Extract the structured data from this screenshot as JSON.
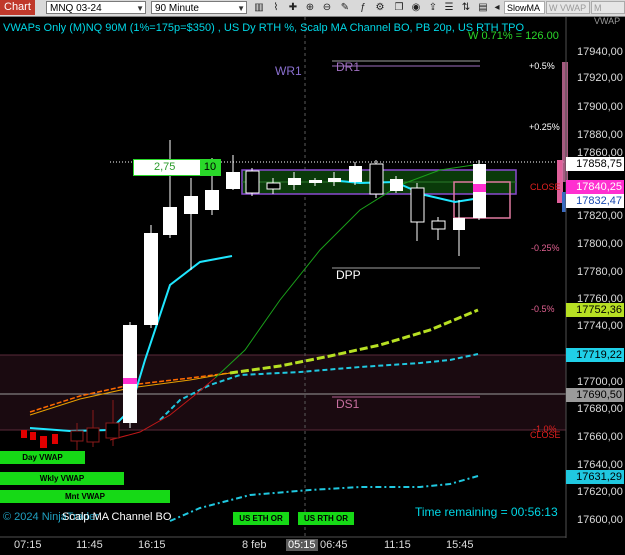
{
  "toolbar": {
    "tab_label": "Chart",
    "instrument": "MNQ 03-24",
    "interval": "90 Minute",
    "indicator": "SlowMA",
    "tab_w_vwap": "W VWAP",
    "tab_m_vwap": "M VWAP"
  },
  "chart": {
    "title": "VWAPs Only (M)NQ 90M  (1%=175p=$350) , US Dy RTH %, Scalp MA Channel BO, PB 20p, US RTH TPO",
    "overlay_text": "W 0.71% = 126.00",
    "copyright": "© 2024 NinjaTrader",
    "scalp_label": "Scalp MA Channel BO",
    "time_remaining": "Time remaining = 00:56:13",
    "callout_value": "2,75",
    "callout_count": "10"
  },
  "levels": {
    "wr1": "WR1",
    "dr1": "DR1",
    "dpp": "DPP",
    "ds1": "DS1"
  },
  "percent_labels": {
    "p05": "+0.5%",
    "p025": "+0.25%",
    "m025": "-0.25%",
    "m05": "-0.5%",
    "m1": "-1.0%",
    "close1": "CLOSE",
    "close2": "CLOSE"
  },
  "buttons": {
    "day_vwap": "Day VWAP",
    "wkly_vwap": "Wkly VWAP",
    "mnt_vwap": "Mnt VWAP",
    "us_eth_or": "US ETH OR",
    "us_rth_or": "US RTH OR"
  },
  "price_axis": {
    "ticks": [
      "17940,00",
      "17920,00",
      "17900,00",
      "17880,00",
      "17860,00",
      "17820,00",
      "17800,00",
      "17780,00",
      "17760,00",
      "17740,00",
      "17700,00",
      "17680,00",
      "17660,00",
      "17640,00",
      "17620,00",
      "17600,00"
    ],
    "boxes": {
      "last": "17858,75",
      "mid": "17840,25",
      "blue": "17832,47",
      "green": "17752,36",
      "cyan": "17719,22",
      "gray": "17690,50",
      "cyan2": "17631,29"
    }
  },
  "time_axis": {
    "ticks": [
      "07:15",
      "11:45",
      "16:15",
      "8 feb",
      "05:15",
      "06:45",
      "11:15",
      "15:45"
    ],
    "highlight": "05:15"
  },
  "colors": {
    "background": "#000000",
    "title": "#00d7e6",
    "day_vwap": "#1fe6ff",
    "week_vwap": "#b7e023",
    "month_vwap": "#20c8e0",
    "bull_candle": "#ffffff",
    "bear_candle": "#000000",
    "magenta": "#ff00ff"
  }
}
